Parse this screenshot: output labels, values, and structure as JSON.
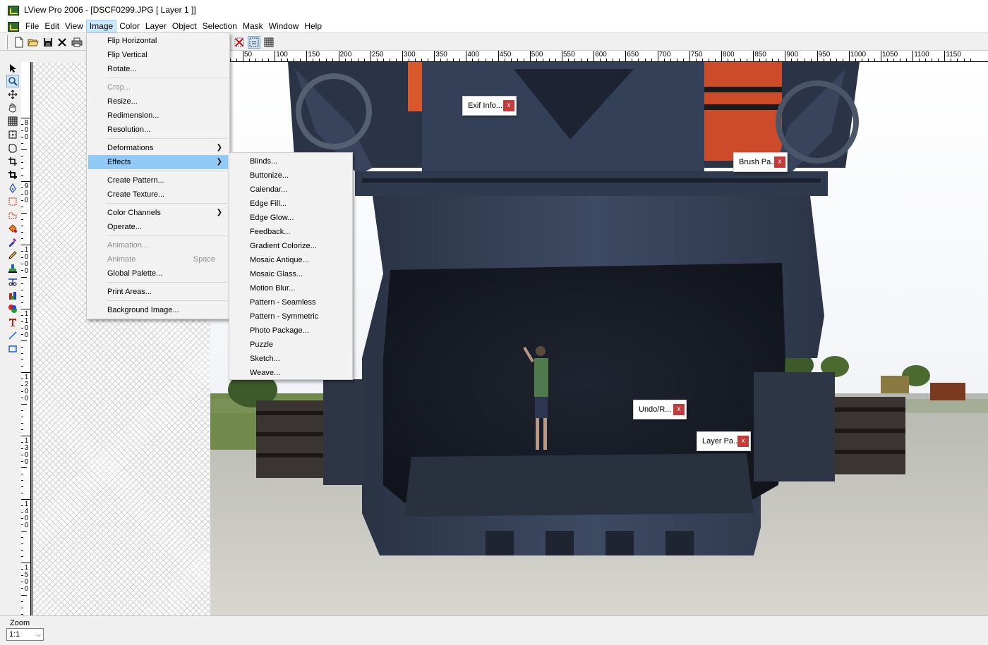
{
  "window": {
    "title": "LView Pro 2006 - [DSCF0299.JPG [ Layer 1 ]]"
  },
  "menubar": {
    "items": [
      "File",
      "Edit",
      "View",
      "Image",
      "Color",
      "Layer",
      "Object",
      "Selection",
      "Mask",
      "Window",
      "Help"
    ],
    "active": "Image"
  },
  "image_menu": {
    "items": [
      {
        "label": "Flip Horizontal",
        "enabled": true
      },
      {
        "label": "Flip Vertical",
        "enabled": true
      },
      {
        "label": "Rotate...",
        "enabled": true
      },
      {
        "label": "Crop...",
        "enabled": false
      },
      {
        "label": "Resize...",
        "enabled": true
      },
      {
        "label": "Redimension...",
        "enabled": true
      },
      {
        "label": "Resolution...",
        "enabled": true
      },
      {
        "label": "Deformations",
        "enabled": true,
        "submenu": true
      },
      {
        "label": "Effects",
        "enabled": true,
        "submenu": true,
        "highlighted": true
      },
      {
        "label": "Create Pattern...",
        "enabled": true
      },
      {
        "label": "Create Texture...",
        "enabled": true
      },
      {
        "label": "Color Channels",
        "enabled": true,
        "submenu": true
      },
      {
        "label": "Operate...",
        "enabled": true
      },
      {
        "label": "Animation...",
        "enabled": false
      },
      {
        "label": "Animate",
        "enabled": false,
        "shortcut": "Space"
      },
      {
        "label": "Global Palette...",
        "enabled": true
      },
      {
        "label": "Print Areas...",
        "enabled": true
      },
      {
        "label": "Background Image...",
        "enabled": true
      }
    ]
  },
  "effects_menu": {
    "items": [
      "Blinds...",
      "Buttonize...",
      "Calendar...",
      "Edge Fill...",
      "Edge Glow...",
      "Feedback...",
      "Gradient Colorize...",
      "Mosaic Antique...",
      "Mosaic Glass...",
      "Motion Blur...",
      "Pattern - Seamless",
      "Pattern - Symmetric",
      "Photo Package...",
      "Puzzle",
      "Sketch...",
      "Weave..."
    ]
  },
  "floating_panels": {
    "exif": {
      "label": "Exif Info...",
      "close": "x"
    },
    "brush": {
      "label": "Brush Pa...",
      "close": "x"
    },
    "undo": {
      "label": "Undo/R...",
      "close": "x"
    },
    "layer": {
      "label": "Layer Pa...",
      "close": "x"
    }
  },
  "ruler": {
    "horizontal": [
      "50",
      "100",
      "150",
      "200",
      "250",
      "300",
      "350",
      "400",
      "450",
      "500",
      "550",
      "600",
      "650",
      "700",
      "750",
      "800",
      "850",
      "900",
      "950",
      "1000",
      "1050",
      "1100",
      "1150"
    ],
    "vertical": [
      "800",
      "900",
      "1000",
      "1100",
      "1200",
      "1300",
      "1400",
      "1500"
    ]
  },
  "status": {
    "zoom_label": "Zoom",
    "zoom_value": "1:1"
  },
  "icons": {
    "toolbar": [
      "new-document-icon",
      "open-folder-icon",
      "save-icon",
      "close-icon",
      "print-icon",
      "no-mask-icon",
      "grid-select-icon",
      "grid-icon"
    ],
    "tools": [
      "pointer-icon",
      "zoom-icon",
      "move-icon",
      "hand-icon",
      "grid-icon",
      "select-rect-icon",
      "lasso-icon",
      "crop-icon",
      "crop-icon",
      "pen-icon",
      "marquee-icon",
      "freeform-select-icon",
      "fill-icon",
      "eyedropper-icon",
      "pencil-icon",
      "stamp-icon",
      "scissors-icon",
      "airbrush-icon",
      "color-replace-icon",
      "text-icon",
      "line-icon",
      "rectangle-icon"
    ]
  }
}
